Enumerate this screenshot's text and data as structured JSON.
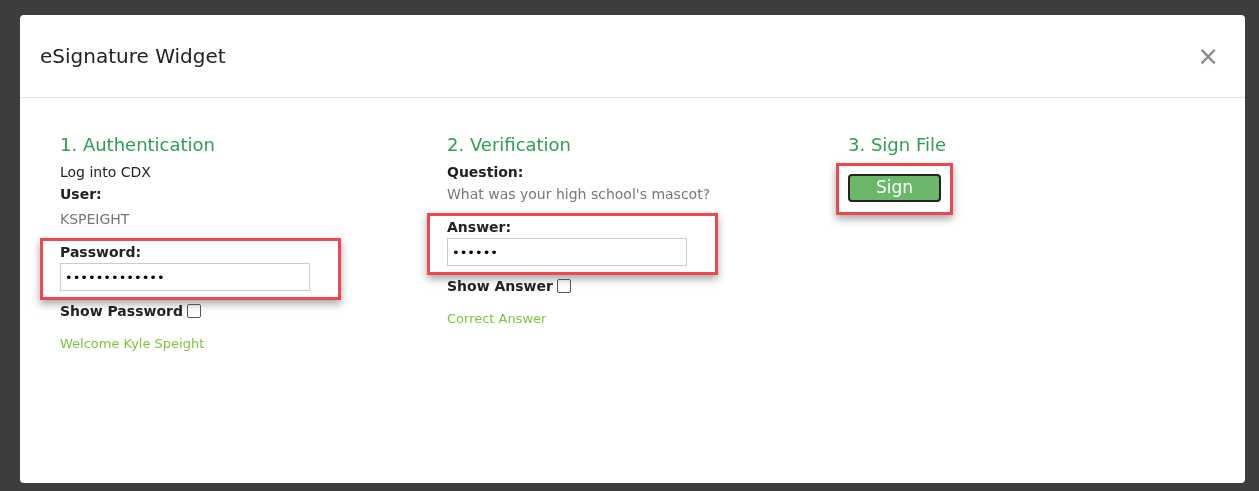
{
  "dialog": {
    "title": "eSignature Widget",
    "close": "×"
  },
  "sections": [
    {
      "kind": "auth",
      "heading": "1. Authentication",
      "intro": "Log into CDX",
      "user_label": "User:",
      "user": "KSPEIGHT",
      "field": {
        "label": "Password:",
        "value": "•••••••••••••",
        "highlighted": true
      },
      "toggle": {
        "label": "Show Password",
        "checked": false
      },
      "status": "Welcome Kyle Speight"
    },
    {
      "kind": "verify",
      "heading": "2. Verification",
      "question_label": "Question:",
      "question": "What was your high school's mascot?",
      "field": {
        "label": "Answer:",
        "value": "••••••",
        "highlighted": true
      },
      "toggle": {
        "label": "Show Answer",
        "checked": false
      },
      "status": "Correct Answer"
    },
    {
      "kind": "sign",
      "heading": "3. Sign File",
      "button": {
        "label": "Sign",
        "highlighted": true
      }
    }
  ]
}
